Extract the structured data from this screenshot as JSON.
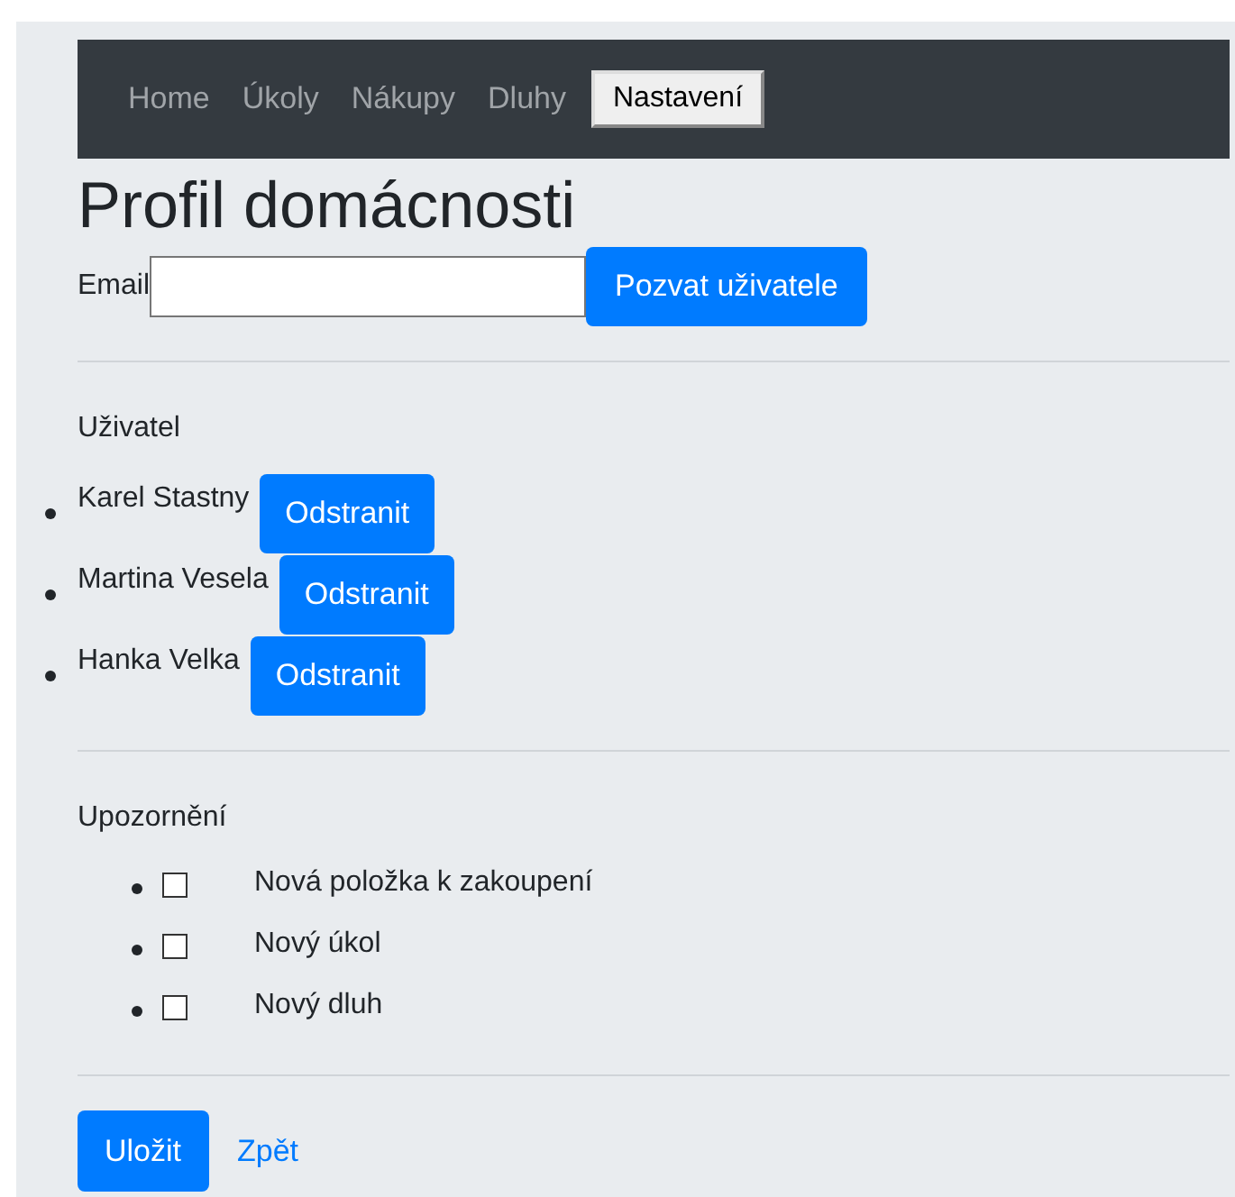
{
  "nav": {
    "items": [
      {
        "label": "Home",
        "selected": false
      },
      {
        "label": "Úkoly",
        "selected": false
      },
      {
        "label": "Nákupy",
        "selected": false
      },
      {
        "label": "Dluhy",
        "selected": false
      },
      {
        "label": "Nastavení",
        "selected": true
      }
    ]
  },
  "title": "Profil domácnosti",
  "invite": {
    "label": "Email",
    "button": "Pozvat uživatele"
  },
  "users": {
    "heading": "Uživatel",
    "items": [
      {
        "name": "Karel Stastny",
        "button": "Odstranit"
      },
      {
        "name": "Martina Vesela",
        "button": "Odstranit"
      },
      {
        "name": "Hanka Velka",
        "button": "Odstranit"
      }
    ]
  },
  "notifications": {
    "heading": "Upozornění",
    "items": [
      {
        "label": "Nová položka k zakoupení",
        "checked": false
      },
      {
        "label": "Nový úkol",
        "checked": false
      },
      {
        "label": "Nový dluh",
        "checked": false
      }
    ]
  },
  "actions": {
    "save": "Uložit",
    "back": "Zpět"
  }
}
